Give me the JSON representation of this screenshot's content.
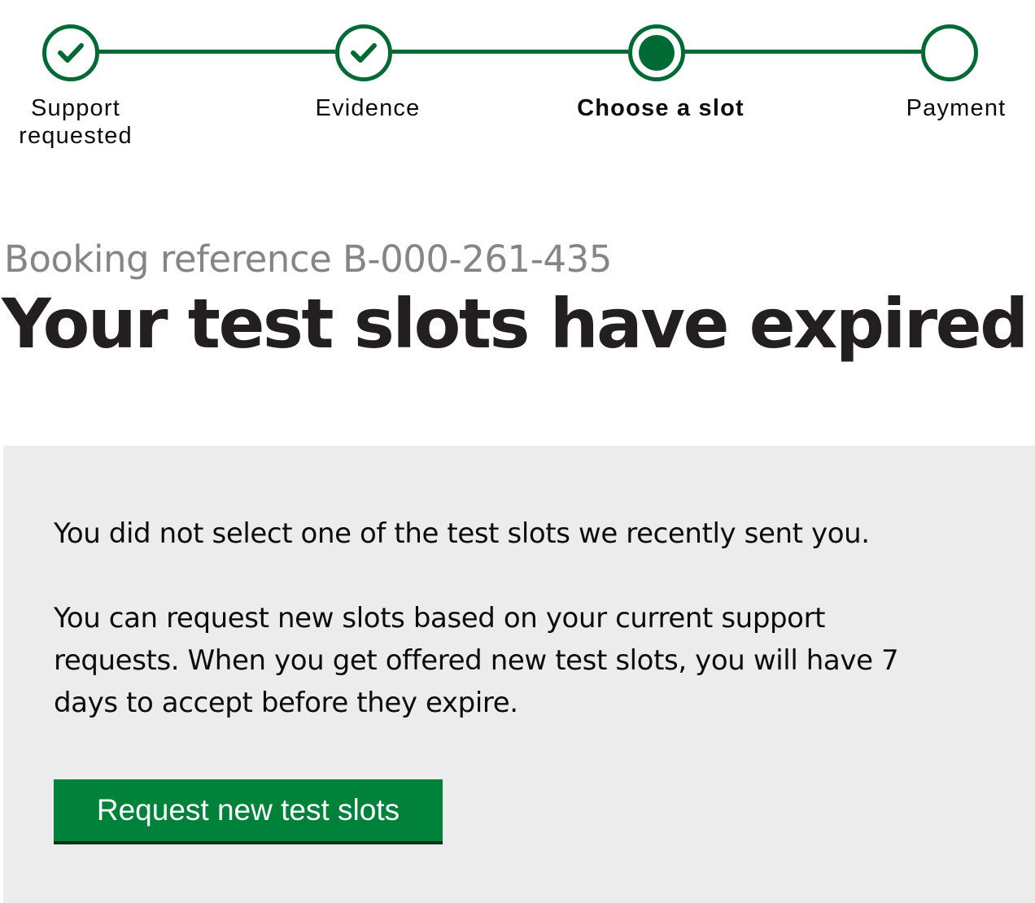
{
  "stepper": {
    "accent_color": "#006a35",
    "steps": [
      {
        "label_line1": "Support",
        "label_line2": "requested",
        "state": "complete",
        "icon": "check-icon"
      },
      {
        "label_line1": "Evidence",
        "label_line2": "",
        "state": "complete",
        "icon": "check-icon"
      },
      {
        "label_line1": "Choose a slot",
        "label_line2": "",
        "state": "current",
        "icon": "current-dot-icon"
      },
      {
        "label_line1": "Payment",
        "label_line2": "",
        "state": "upcoming",
        "icon": "empty-circle-icon"
      }
    ]
  },
  "header": {
    "caption": "Booking reference B-000-261-435",
    "title": "Your test slots have expired"
  },
  "panel": {
    "background_color": "#ececec",
    "paragraph1": "You did not select one of the test slots we recently sent you.",
    "paragraph2": "You can request new slots based on your current support requests. When you get offered new test slots, you will have 7 days to accept before they expire.",
    "button_label": "Request new test slots",
    "button_color": "#00823b"
  }
}
